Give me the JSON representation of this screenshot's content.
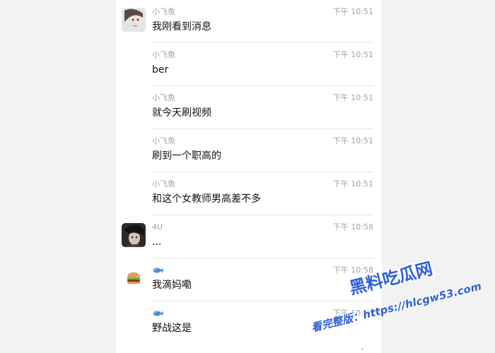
{
  "messages": [
    {
      "sender": "小飞魚",
      "time": "下午 10:51",
      "text": "我刚看到消息"
    },
    {
      "sender": "小飞魚",
      "time": "下午 10:51",
      "text": "ber"
    },
    {
      "sender": "小飞魚",
      "time": "下午 10:51",
      "text": "就今天刷视频"
    },
    {
      "sender": "小飞魚",
      "time": "下午 10:51",
      "text": "刷到一个职高的"
    },
    {
      "sender": "小飞魚",
      "time": "下午 10:51",
      "text": "和这个女教师男高差不多"
    },
    {
      "sender": "4U",
      "time": "下午 10:58",
      "text": "..."
    },
    {
      "sender": "",
      "time": "下午 10:58",
      "text": "我滴妈嘞"
    },
    {
      "sender": "",
      "time": "下午 10:58",
      "text": "野战这是"
    }
  ],
  "watermark": {
    "title": "黑料吃瓜网",
    "url": "看完整版：https://hlcgw53.com"
  },
  "colors": {
    "watermark": "#2f5fd8",
    "meta_text": "#a3a3a3",
    "body_text": "#111111"
  }
}
